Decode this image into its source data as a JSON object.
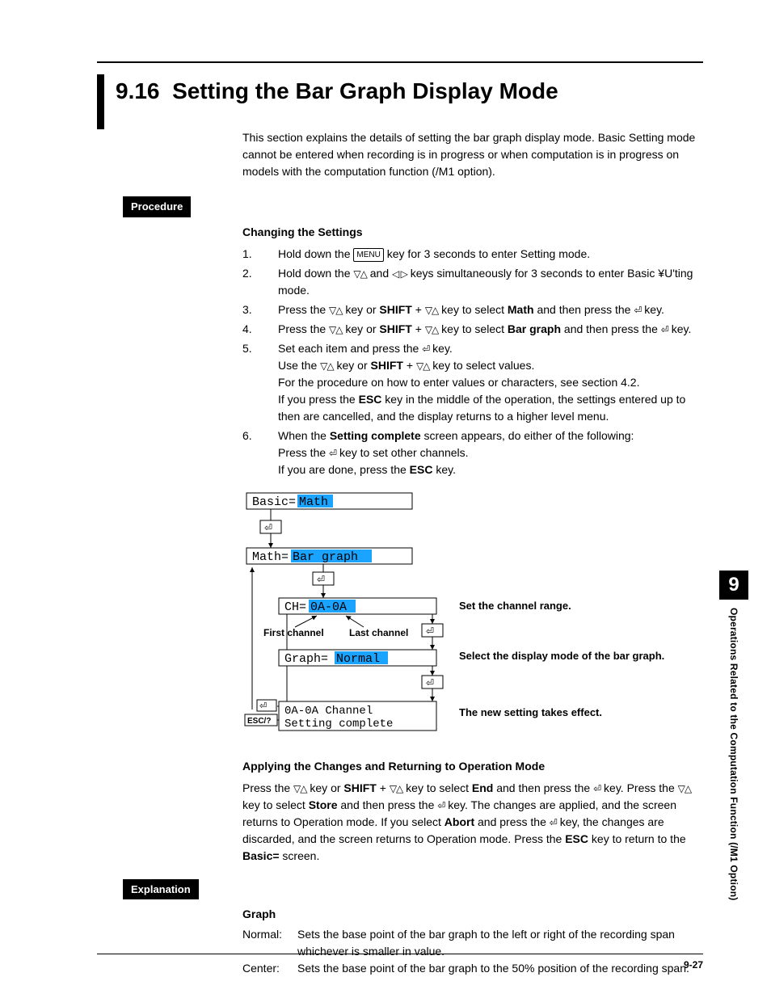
{
  "section_number": "9.16",
  "section_title": "Setting the Bar Graph Display Mode",
  "intro": "This section explains the details of setting the bar graph display mode. Basic Setting mode cannot be entered when recording is in progress or when computation is in progress on models with the computation function (/M1 option).",
  "labels": {
    "procedure": "Procedure",
    "explanation": "Explanation"
  },
  "subhead1": "Changing the Settings",
  "menu_key": "MENU",
  "updown": "▽△",
  "leftright": "◁ ▷",
  "enter": "⏎",
  "steps": {
    "s1a": "Hold down the ",
    "s1b": " key for 3 seconds to enter Setting mode.",
    "s2a": "Hold down the ",
    "s2b": " and ",
    "s2c": " keys simultaneously for 3 seconds to enter Basic ¥U'ting mode.",
    "s3a": "Press the ",
    "s3b": " key or ",
    "s3c": " key to select ",
    "s3d": " and then press the ",
    "s3e": " key.",
    "shift": "SHIFT",
    "plus": " + ",
    "math": "Math",
    "s4d": " and then press the ",
    "bargraph": "Bar graph",
    "s5a": "Set each item and press the ",
    "s5b": " key.",
    "s5c": "Use the ",
    "s5d": " key to select values.",
    "s5e": "For the procedure on how to enter values or characters, see section 4.2.",
    "s5f": "If you press the ",
    "s5g": " key in the middle of the operation, the settings entered up to then are cancelled, and the display returns to a higher level menu.",
    "esc": "ESC",
    "s6a": "When the ",
    "s6b": "Setting complete",
    "s6c": " screen appears, do either of the following:",
    "s6d": "Press the ",
    "s6e": " key to set other channels.",
    "s6f": "If you are done, press the ",
    "s6g": " key."
  },
  "flow": {
    "basic_lhs": "Basic=",
    "basic_val": "Math",
    "math_lhs": "Math=",
    "math_val": "Bar graph",
    "ch_lhs": "CH=",
    "ch_val": "0A-0A",
    "graph_lhs": "Graph=",
    "graph_val": "Normal",
    "final1": "0A-0A Channel",
    "final2": "Setting complete",
    "first_ch": "First channel",
    "last_ch": "Last channel",
    "esc_btn": "ESC/?",
    "ann1": "Set the channel range.",
    "ann2": "Select the display mode of the bar graph.",
    "ann3": "The new setting takes effect."
  },
  "subhead2": "Applying the Changes and Returning to Operation Mode",
  "apply": {
    "a1": "Press the ",
    "a2": " key to select ",
    "end": "End",
    "a3": " key.  Press the ",
    "store": "Store",
    "a4": " key.  The changes are applied, and the screen returns to Operation mode.  If you select ",
    "abort": "Abort",
    "a5": " and press the ",
    "a6": " key, the changes are discarded, and the screen returns to Operation mode.  Press the ",
    "a7": " key to return to the ",
    "basic_eq": "Basic=",
    "a8": " screen."
  },
  "explain": {
    "head": "Graph",
    "k1": "Normal:",
    "v1": "Sets the base point of the bar graph to the left or right of the recording span whichever is smaller in value.",
    "k2": "Center:",
    "v2": "Sets the base point of the bar graph to the 50% position of the recording span."
  },
  "side": {
    "chapter": "9",
    "title": "Operations Related to the Computation Function (/M1 Option)"
  },
  "page_no": "9-27"
}
